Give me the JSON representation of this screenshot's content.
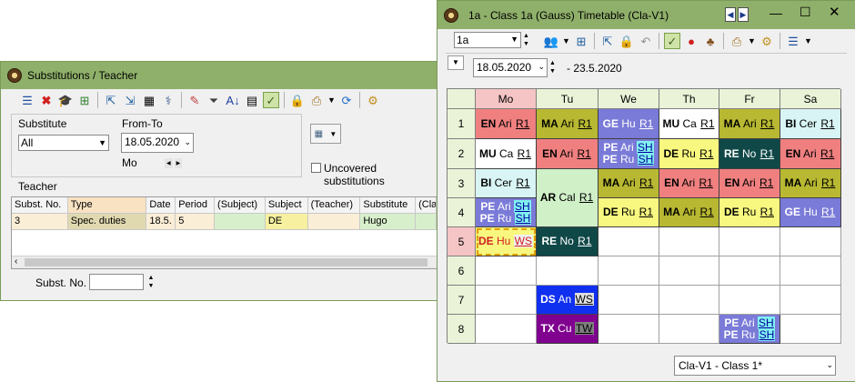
{
  "left_window": {
    "title": "Substitutions / Teacher",
    "toolbar_icons": [
      "list-icon",
      "delete-icon",
      "graduation-cap-icon",
      "add-icon",
      "export-icon",
      "import-icon",
      "calculator-icon",
      "stethoscope-icon",
      "wizard-icon",
      "filter-icon",
      "sort-icon",
      "columns-icon",
      "edit-mode-icon",
      "lock-icon",
      "print-icon",
      "dropdown-arrow-icon",
      "refresh-icon",
      "settings-icon"
    ],
    "substitute_label": "Substitute",
    "substitute_value": "All",
    "fromto_label": "From-To",
    "date_value": "18.05.2020",
    "day_label": "Mo",
    "nav_prev": "◀",
    "nav_next": "▶",
    "uncovered_label": "Uncovered substitutions",
    "teacher_label": "Teacher",
    "columns": [
      "Subst. No.",
      "Type",
      "Date",
      "Period",
      "(Subject)",
      "Subject",
      "(Teacher)",
      "Substitute",
      "(Cla"
    ],
    "row": [
      "3",
      "Spec. duties",
      "18.5.",
      "5",
      "",
      "DE",
      "",
      "Hugo",
      ""
    ],
    "subst_no_label": "Subst. No.",
    "subst_no_value": ""
  },
  "right_window": {
    "title": "1a - Class 1a (Gauss)  Timetable  (Cla-V1)",
    "class_value": "1a",
    "date_value": "18.05.2020",
    "date_range_end": "- 23.5.2020",
    "days": [
      "Mo",
      "Tu",
      "We",
      "Th",
      "Fr",
      "Sa"
    ],
    "periods": [
      "1",
      "2",
      "3",
      "4",
      "5",
      "6",
      "7",
      "8"
    ],
    "footer_select": "Cla-V1 - Class 1*",
    "lessons": [
      {
        "d": 0,
        "p": 0,
        "span": 1,
        "bg": "#f08080",
        "lines": [
          {
            "s": "EN",
            "t": "Ari",
            "r": "R1"
          }
        ]
      },
      {
        "d": 1,
        "p": 0,
        "span": 1,
        "bg": "#b8b832",
        "lines": [
          {
            "s": "MA",
            "t": "Ari",
            "r": "R1"
          }
        ]
      },
      {
        "d": 2,
        "p": 0,
        "span": 1,
        "bg": "#7a7ad8",
        "fg": "#ffffff",
        "lines": [
          {
            "s": "GE",
            "t": "Hu",
            "r": "R1"
          }
        ]
      },
      {
        "d": 3,
        "p": 0,
        "span": 1,
        "bg": "#ffffff",
        "lines": [
          {
            "s": "MU",
            "t": "Ca",
            "r": "R1"
          }
        ]
      },
      {
        "d": 4,
        "p": 0,
        "span": 1,
        "bg": "#b8b832",
        "lines": [
          {
            "s": "MA",
            "t": "Ari",
            "r": "R1"
          }
        ]
      },
      {
        "d": 5,
        "p": 0,
        "span": 1,
        "bg": "#d8f4f4",
        "lines": [
          {
            "s": "BI",
            "t": "Cer",
            "r": "R1"
          }
        ]
      },
      {
        "d": 0,
        "p": 1,
        "span": 1,
        "bg": "#ffffff",
        "lines": [
          {
            "s": "MU",
            "t": "Ca",
            "r": "R1"
          }
        ]
      },
      {
        "d": 1,
        "p": 1,
        "span": 1,
        "bg": "#f08080",
        "lines": [
          {
            "s": "EN",
            "t": "Ari",
            "r": "R1"
          }
        ]
      },
      {
        "d": 2,
        "p": 1,
        "span": 1,
        "bg": "#7a7ad8",
        "fg": "#ffffff",
        "lines": [
          {
            "s": "PE",
            "t": "Ari",
            "r": "SH",
            "rh": "#80f0f0"
          },
          {
            "s": "PE",
            "t": "Ru",
            "r": "SH",
            "rh": "#80f0f0"
          }
        ]
      },
      {
        "d": 3,
        "p": 1,
        "span": 1,
        "bg": "#f8f880",
        "lines": [
          {
            "s": "DE",
            "t": "Ru",
            "r": "R1"
          }
        ]
      },
      {
        "d": 4,
        "p": 1,
        "span": 1,
        "bg": "#104848",
        "fg": "#ffffff",
        "lines": [
          {
            "s": "RE",
            "t": "No",
            "r": "R1"
          }
        ]
      },
      {
        "d": 5,
        "p": 1,
        "span": 1,
        "bg": "#f08080",
        "lines": [
          {
            "s": "EN",
            "t": "Ari",
            "r": "R1"
          }
        ]
      },
      {
        "d": 0,
        "p": 2,
        "span": 1,
        "bg": "#d8f4f4",
        "lines": [
          {
            "s": "BI",
            "t": "Cer",
            "r": "R1"
          }
        ]
      },
      {
        "d": 1,
        "p": 2,
        "span": 2,
        "bg": "#d0f0c8",
        "lines": [
          {
            "s": "AR",
            "t": "Cal",
            "r": "R1"
          }
        ]
      },
      {
        "d": 2,
        "p": 2,
        "span": 1,
        "bg": "#b8b832",
        "lines": [
          {
            "s": "MA",
            "t": "Ari",
            "r": "R1"
          }
        ]
      },
      {
        "d": 3,
        "p": 2,
        "span": 1,
        "bg": "#f08080",
        "lines": [
          {
            "s": "EN",
            "t": "Ari",
            "r": "R1"
          }
        ]
      },
      {
        "d": 4,
        "p": 2,
        "span": 1,
        "bg": "#f08080",
        "lines": [
          {
            "s": "EN",
            "t": "Ari",
            "r": "R1"
          }
        ]
      },
      {
        "d": 5,
        "p": 2,
        "span": 1,
        "bg": "#b8b832",
        "lines": [
          {
            "s": "MA",
            "t": "Ari",
            "r": "R1"
          }
        ]
      },
      {
        "d": 0,
        "p": 3,
        "span": 1,
        "bg": "#7a7ad8",
        "fg": "#ffffff",
        "lines": [
          {
            "s": "PE",
            "t": "Ari",
            "r": "SH",
            "rh": "#80f0f0"
          },
          {
            "s": "PE",
            "t": "Ru",
            "r": "SH",
            "rh": "#80f0f0"
          }
        ]
      },
      {
        "d": 2,
        "p": 3,
        "span": 1,
        "bg": "#f8f880",
        "lines": [
          {
            "s": "DE",
            "t": "Ru",
            "r": "R1"
          }
        ]
      },
      {
        "d": 3,
        "p": 3,
        "span": 1,
        "bg": "#b8b832",
        "lines": [
          {
            "s": "MA",
            "t": "Ari",
            "r": "R1"
          }
        ]
      },
      {
        "d": 4,
        "p": 3,
        "span": 1,
        "bg": "#f8f880",
        "lines": [
          {
            "s": "DE",
            "t": "Ru",
            "r": "R1"
          }
        ]
      },
      {
        "d": 5,
        "p": 3,
        "span": 1,
        "bg": "#7a7ad8",
        "fg": "#ffffff",
        "lines": [
          {
            "s": "GE",
            "t": "Hu",
            "r": "R1"
          }
        ]
      },
      {
        "d": 0,
        "p": 4,
        "span": 1,
        "bg": "#f8f880",
        "fg": "#d02020",
        "dashed": true,
        "lines": [
          {
            "s": "DE",
            "t": "Hu",
            "r": "WS",
            "rb": "#f0f0f0"
          }
        ]
      },
      {
        "d": 1,
        "p": 4,
        "span": 1,
        "bg": "#104848",
        "fg": "#ffffff",
        "lines": [
          {
            "s": "RE",
            "t": "No",
            "r": "R1"
          }
        ]
      },
      {
        "d": 1,
        "p": 6,
        "span": 1,
        "bg": "#1030f0",
        "fg": "#ffffff",
        "lines": [
          {
            "s": "DS",
            "t": "An",
            "r": "WS",
            "rh": "#e0e0e0",
            "rf": "#000000"
          }
        ]
      },
      {
        "d": 1,
        "p": 7,
        "span": 1,
        "bg": "#800090",
        "fg": "#ffffff",
        "lines": [
          {
            "s": "TX",
            "t": "Cu",
            "r": "TW",
            "rh": "#808080",
            "rf": "#000000"
          }
        ]
      },
      {
        "d": 4,
        "p": 7,
        "span": 1,
        "bg": "#7a7ad8",
        "fg": "#ffffff",
        "lines": [
          {
            "s": "PE",
            "t": "Ari",
            "r": "SH",
            "rh": "#80f0f0"
          },
          {
            "s": "PE",
            "t": "Ru",
            "r": "SH",
            "rh": "#80f0f0"
          }
        ]
      }
    ]
  }
}
